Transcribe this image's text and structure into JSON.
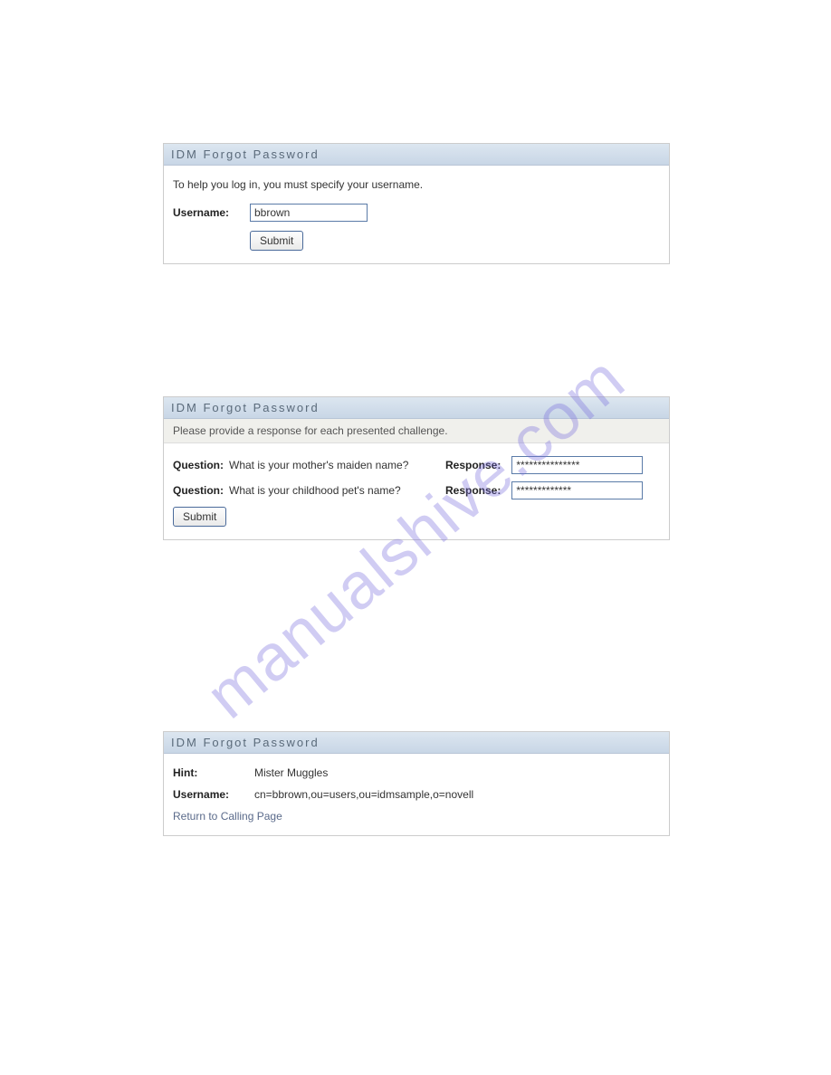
{
  "watermark": "manualshive.com",
  "panel1": {
    "title": "IDM Forgot Password",
    "help_text": "To help you log in, you must specify your username.",
    "username_label": "Username:",
    "username_value": "bbrown",
    "submit_label": "Submit"
  },
  "panel2": {
    "title": "IDM Forgot Password",
    "subheader": "Please provide a response for each presented challenge.",
    "challenges": [
      {
        "q_label": "Question:",
        "q_text": "What is your mother's maiden name?",
        "r_label": "Response:",
        "r_value": "***************"
      },
      {
        "q_label": "Question:",
        "q_text": "What is your childhood pet's name?",
        "r_label": "Response:",
        "r_value": "*************"
      }
    ],
    "submit_label": "Submit"
  },
  "panel3": {
    "title": "IDM Forgot Password",
    "hint_label": "Hint:",
    "hint_value": "Mister Muggles",
    "username_label": "Username:",
    "username_value": "cn=bbrown,ou=users,ou=idmsample,o=novell",
    "return_link": "Return to Calling Page"
  }
}
